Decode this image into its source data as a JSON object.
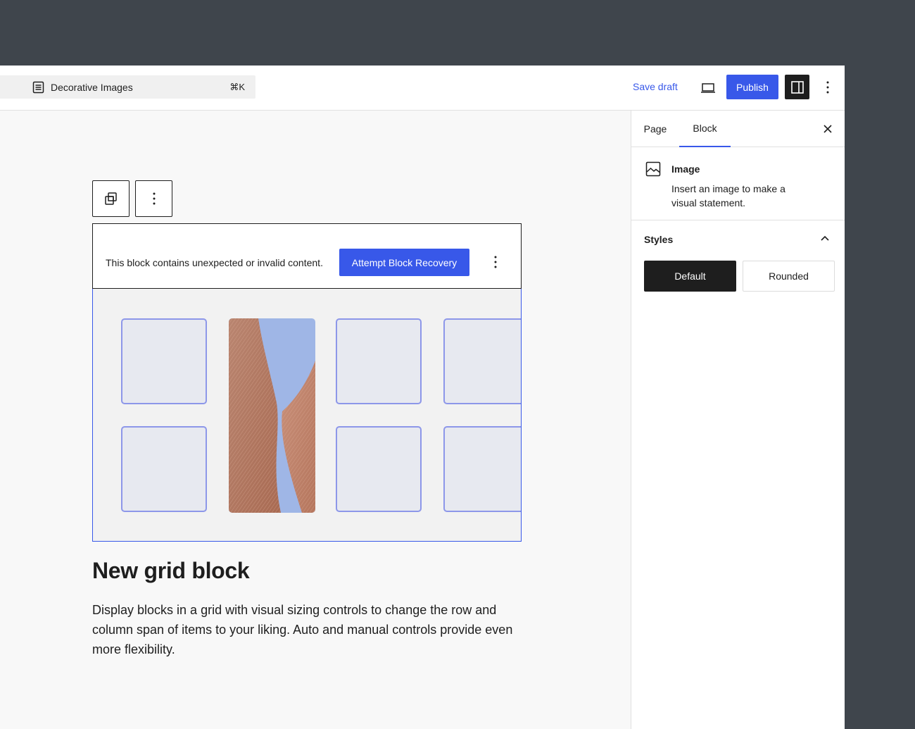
{
  "topbar": {
    "document_title": "Decorative Images",
    "shortcut": "⌘K",
    "save_draft_label": "Save draft",
    "publish_label": "Publish"
  },
  "canvas": {
    "warning": {
      "message": "This block contains unexpected or invalid content.",
      "recovery_label": "Attempt Block Recovery"
    },
    "heading": "New grid block",
    "paragraph": "Display blocks in a grid with visual sizing controls to change the row and column span of items to your liking. Auto and manual controls provide even more flexibility."
  },
  "sidebar": {
    "tabs": [
      {
        "label": "Page"
      },
      {
        "label": "Block"
      }
    ],
    "active_tab": "Block",
    "block_card": {
      "name": "Image",
      "description": "Insert an image to make a visual statement."
    },
    "styles": {
      "title": "Styles",
      "options": [
        {
          "label": "Default"
        },
        {
          "label": "Rounded"
        }
      ],
      "selected": "Default"
    }
  },
  "colors": {
    "accent": "#3858e9",
    "dark": "#1e1e1e",
    "backdrop": "#3f454c"
  }
}
